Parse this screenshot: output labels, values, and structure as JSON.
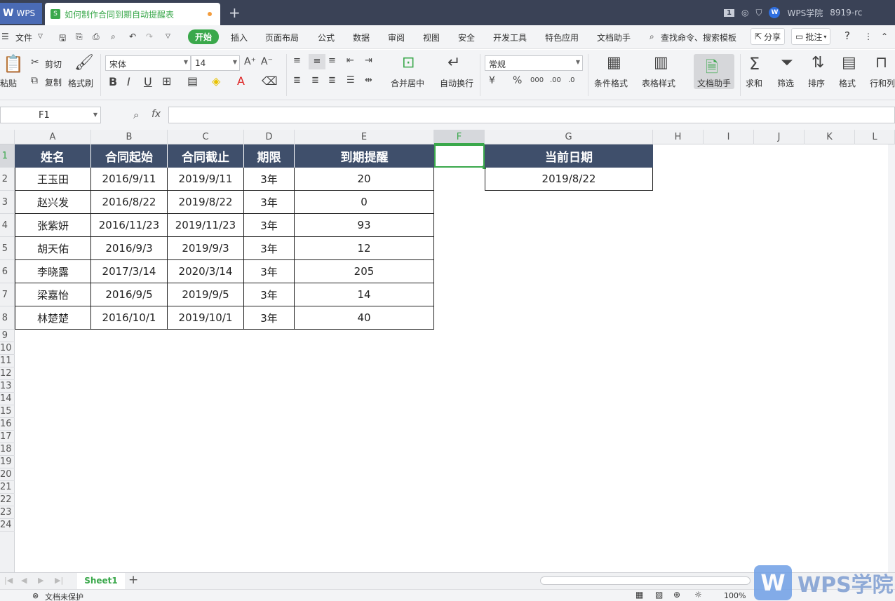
{
  "titlebar": {
    "app_tab": "WPS",
    "doc_tab": "如何制作合同到期自动提醒表",
    "new_tab": "+",
    "page_badge": "1",
    "academy": "WPS学院",
    "user": "8919-rc"
  },
  "menu": {
    "file": "文件",
    "items": [
      "开始",
      "插入",
      "页面布局",
      "公式",
      "数据",
      "审阅",
      "视图",
      "安全",
      "开发工具",
      "特色应用",
      "文档助手"
    ],
    "search": "查找命令、搜索模板",
    "share": "分享",
    "comment": "批注",
    "help": "?"
  },
  "ribbon": {
    "paste": "粘贴",
    "cut": "剪切",
    "copy": "复制",
    "format_painter": "格式刷",
    "font_name": "宋体",
    "font_size": "14",
    "merge_center": "合并居中",
    "wrap_text": "自动换行",
    "number_format": "常规",
    "conditional_format": "条件格式",
    "table_style": "表格样式",
    "doc_assistant": "文档助手",
    "sum": "求和",
    "filter": "筛选",
    "sort": "排序",
    "format": "格式",
    "rows_cols": "行和列"
  },
  "formula_bar": {
    "name_box": "F1",
    "fx": "fx",
    "value": ""
  },
  "grid": {
    "columns": [
      "A",
      "B",
      "C",
      "D",
      "E",
      "F",
      "G",
      "H",
      "I",
      "J",
      "K",
      "L"
    ],
    "rows": [
      "1",
      "2",
      "3",
      "4",
      "5",
      "6",
      "7",
      "8",
      "9",
      "10",
      "11",
      "12",
      "13",
      "14",
      "15",
      "16",
      "17",
      "18",
      "19",
      "20",
      "21",
      "22",
      "23",
      "24"
    ],
    "selected_cell": "F1",
    "table_headers": [
      "姓名",
      "合同起始",
      "合同截止",
      "期限",
      "到期提醒"
    ],
    "table_rows": [
      [
        "王玉田",
        "2016/9/11",
        "2019/9/11",
        "3年",
        "20"
      ],
      [
        "赵兴发",
        "2016/8/22",
        "2019/8/22",
        "3年",
        "0"
      ],
      [
        "张紫妍",
        "2016/11/23",
        "2019/11/23",
        "3年",
        "93"
      ],
      [
        "胡天佑",
        "2016/9/3",
        "2019/9/3",
        "3年",
        "12"
      ],
      [
        "李晓露",
        "2017/3/14",
        "2020/3/14",
        "3年",
        "205"
      ],
      [
        "梁嘉怡",
        "2016/9/5",
        "2019/9/5",
        "3年",
        "14"
      ],
      [
        "林楚楚",
        "2016/10/1",
        "2019/10/1",
        "3年",
        "40"
      ]
    ],
    "current_date_header": "当前日期",
    "current_date_value": "2019/8/22"
  },
  "sheet_tabs": {
    "active": "Sheet1",
    "add": "+"
  },
  "status": {
    "protect": "文档未保护",
    "zoom": "100%"
  },
  "watermark": {
    "logo": "W",
    "text": "WPS学院"
  },
  "colors": {
    "accent_green": "#3aa84b",
    "header_fill": "#3f4f6b",
    "titlebar": "#3a4256"
  }
}
